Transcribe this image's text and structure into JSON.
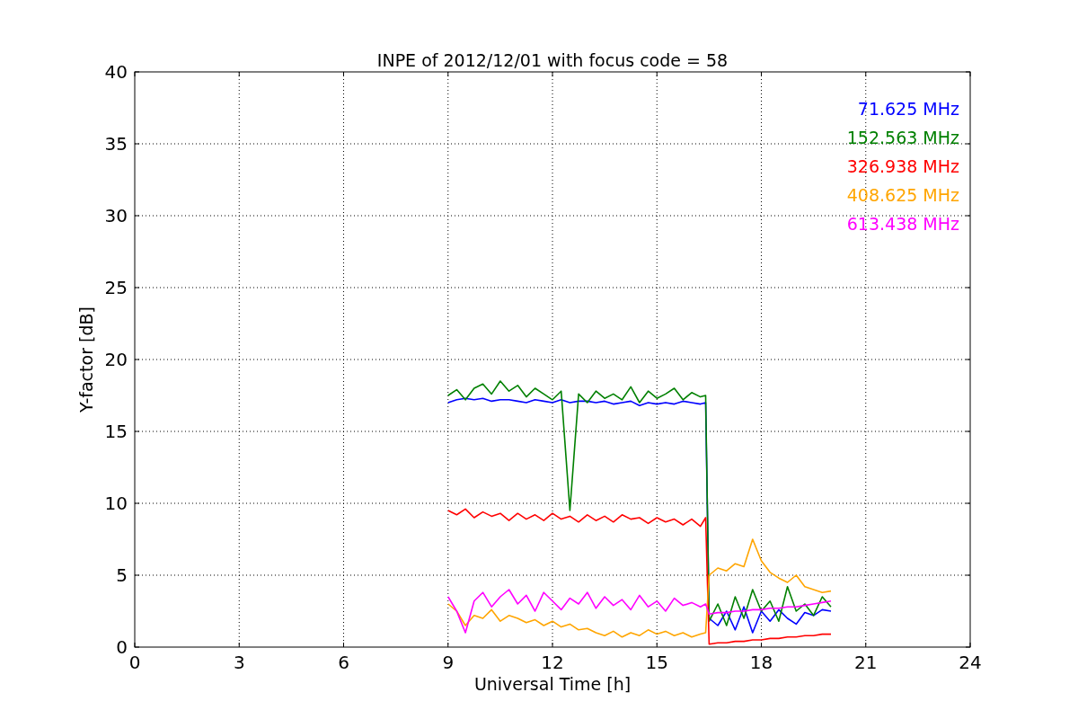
{
  "chart_data": {
    "type": "line",
    "title": "INPE of 2012/12/01 with focus code = 58",
    "xlabel": "Universal Time [h]",
    "ylabel": "Y-factor [dB]",
    "xlim": [
      0,
      24
    ],
    "ylim": [
      0,
      40
    ],
    "xticks": [
      0,
      3,
      6,
      9,
      12,
      15,
      18,
      21,
      24
    ],
    "yticks": [
      0,
      5,
      10,
      15,
      20,
      25,
      30,
      35,
      40
    ],
    "grid": true,
    "x": [
      9,
      9.25,
      9.5,
      9.75,
      10,
      10.25,
      10.5,
      10.75,
      11,
      11.25,
      11.5,
      11.75,
      12,
      12.25,
      12.5,
      12.75,
      13,
      13.25,
      13.5,
      13.75,
      14,
      14.25,
      14.5,
      14.75,
      15,
      15.25,
      15.5,
      15.75,
      16,
      16.25,
      16.4,
      16.5,
      16.75,
      17,
      17.25,
      17.5,
      17.75,
      18,
      18.25,
      18.5,
      18.75,
      19,
      19.25,
      19.5,
      19.75,
      20
    ],
    "series": [
      {
        "name": "71.625 MHz",
        "color": "#0000ff",
        "values": [
          17.0,
          17.2,
          17.3,
          17.2,
          17.3,
          17.1,
          17.2,
          17.2,
          17.1,
          17.0,
          17.2,
          17.1,
          17.0,
          17.2,
          17.0,
          17.1,
          17.1,
          17.0,
          17.1,
          16.9,
          17.0,
          17.1,
          16.8,
          17.0,
          16.9,
          17.0,
          16.9,
          17.1,
          17.0,
          16.9,
          17.0,
          2.0,
          1.5,
          2.5,
          1.2,
          2.8,
          1.0,
          2.5,
          1.8,
          2.6,
          2.0,
          1.6,
          2.4,
          2.2,
          2.6,
          2.5
        ]
      },
      {
        "name": "152.563 MHz",
        "color": "#008000",
        "values": [
          17.5,
          17.9,
          17.2,
          18.0,
          18.3,
          17.6,
          18.5,
          17.8,
          18.2,
          17.4,
          18.0,
          17.6,
          17.2,
          17.8,
          9.5,
          17.6,
          17.0,
          17.8,
          17.3,
          17.6,
          17.2,
          18.1,
          17.0,
          17.8,
          17.3,
          17.6,
          18.0,
          17.2,
          17.7,
          17.4,
          17.5,
          1.8,
          3.0,
          1.5,
          3.5,
          2.0,
          4.0,
          2.5,
          3.2,
          1.8,
          4.2,
          2.5,
          3.0,
          2.2,
          3.5,
          2.8
        ]
      },
      {
        "name": "326.938 MHz",
        "color": "#ff0000",
        "values": [
          9.5,
          9.2,
          9.6,
          9.0,
          9.4,
          9.1,
          9.3,
          8.8,
          9.3,
          8.9,
          9.2,
          8.8,
          9.3,
          8.9,
          9.1,
          8.7,
          9.2,
          8.8,
          9.1,
          8.7,
          9.2,
          8.9,
          9.0,
          8.6,
          9.0,
          8.7,
          8.9,
          8.5,
          8.9,
          8.4,
          9.0,
          0.2,
          0.3,
          0.3,
          0.4,
          0.4,
          0.5,
          0.5,
          0.6,
          0.6,
          0.7,
          0.7,
          0.8,
          0.8,
          0.9,
          0.9
        ]
      },
      {
        "name": "408.625 MHz",
        "color": "#ffa500",
        "values": [
          3.0,
          2.5,
          1.5,
          2.2,
          2.0,
          2.6,
          1.8,
          2.2,
          2.0,
          1.7,
          1.9,
          1.5,
          1.8,
          1.4,
          1.6,
          1.2,
          1.3,
          1.0,
          0.8,
          1.1,
          0.7,
          1.0,
          0.8,
          1.2,
          0.9,
          1.1,
          0.8,
          1.0,
          0.7,
          0.9,
          1.0,
          5.0,
          5.5,
          5.3,
          5.8,
          5.6,
          7.5,
          6.0,
          5.2,
          4.8,
          4.5,
          5.0,
          4.2,
          4.0,
          3.8,
          3.9
        ]
      },
      {
        "name": "613.438 MHz",
        "color": "#ff00ff",
        "values": [
          3.5,
          2.5,
          1.0,
          3.2,
          3.8,
          2.8,
          3.5,
          4.0,
          3.0,
          3.6,
          2.5,
          3.8,
          3.2,
          2.6,
          3.4,
          3.0,
          3.8,
          2.7,
          3.5,
          2.9,
          3.3,
          2.6,
          3.6,
          2.8,
          3.2,
          2.5,
          3.4,
          2.9,
          3.1,
          2.8,
          3.0,
          2.3,
          2.4,
          2.4,
          2.5,
          2.5,
          2.6,
          2.6,
          2.7,
          2.7,
          2.8,
          2.8,
          2.9,
          3.0,
          3.1,
          3.2
        ]
      }
    ]
  }
}
